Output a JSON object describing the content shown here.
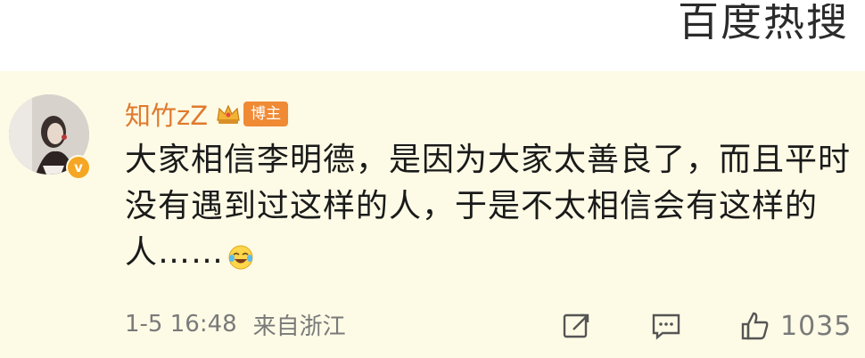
{
  "watermark": {
    "text": "百度热搜"
  },
  "comment": {
    "username": "知竹zZ",
    "badge_label": "博主",
    "text": "大家相信李明德，是因为大家太善良了，而且平时没有遇到过这样的人，于是不太相信会有这样的人……",
    "time": "1-5 16:48",
    "source": "来自浙江",
    "like_count": "1035"
  },
  "icons": {
    "avatar": "avatar-photo",
    "verified": "verified-badge-icon",
    "crown": "crown-icon",
    "emoji": "laugh-cry-emoji-icon",
    "share": "share-icon",
    "comment": "comment-icon",
    "like": "like-icon"
  },
  "colors": {
    "background": "#fdfbe6",
    "username": "#e07a2e",
    "badge": "#f08a34",
    "verified": "#f5a623",
    "meta": "#7a7a7a",
    "text": "#1a1a1a"
  }
}
